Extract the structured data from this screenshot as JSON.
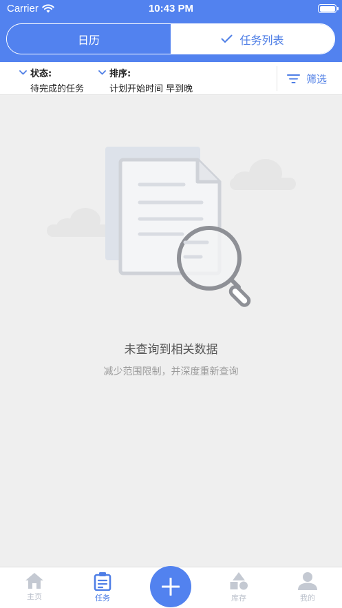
{
  "status_bar": {
    "carrier": "Carrier",
    "time": "10:43 PM"
  },
  "segment": {
    "calendar_label": "日历",
    "task_list_label": "任务列表",
    "active": "task_list"
  },
  "filters": {
    "status_title": "状态:",
    "status_value": "待完成的任务",
    "sort_title": "排序:",
    "sort_value": "计划开始时间 早到晚",
    "screen_label": "筛选"
  },
  "empty_state": {
    "title": "未查询到相关数据",
    "subtitle": "减少范围限制，并深度重新查询"
  },
  "tab_bar": {
    "items": [
      {
        "label": "主页",
        "icon": "home-icon",
        "active": false
      },
      {
        "label": "任务",
        "icon": "clipboard-icon",
        "active": true
      },
      {
        "label": "库存",
        "icon": "shapes-icon",
        "active": false
      },
      {
        "label": "我的",
        "icon": "user-icon",
        "active": false
      }
    ],
    "fab_icon": "plus-icon"
  },
  "colors": {
    "primary": "#5282ef",
    "accent_text": "#4e7ee6",
    "background": "#efefef",
    "inactive_tab": "#bcc2cc"
  }
}
